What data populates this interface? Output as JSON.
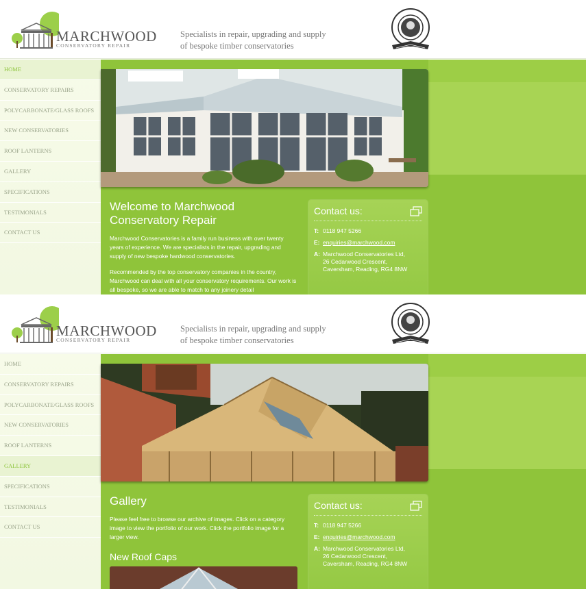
{
  "brand": {
    "name": "MARCHWOOD",
    "sub": "CONSERVATORY REPAIR",
    "tagline_1": "Specialists in repair, upgrading and supply",
    "tagline_2": "of bespoke timber conservatories",
    "badge_alt": "Guild of Master Craftsmen"
  },
  "nav": [
    {
      "label": "HOME"
    },
    {
      "label": "CONSERVATORY REPAIRS"
    },
    {
      "label": "POLYCARBONATE/GLASS ROOFS"
    },
    {
      "label": "NEW CONSERVATORIES"
    },
    {
      "label": "ROOF LANTERNS"
    },
    {
      "label": "GALLERY"
    },
    {
      "label": "SPECIFICATIONS"
    },
    {
      "label": "TESTIMONIALS"
    },
    {
      "label": "CONTACT US"
    }
  ],
  "contact": {
    "title": "Contact us:",
    "t_label": "T:",
    "phone": "0118 947 5266",
    "e_label": "E:",
    "email": "enquiries@marchwood.com",
    "a_label": "A:",
    "addr_1": "Marchwood Conservatories Ltd,",
    "addr_2": "26 Cedarwood Crescent,",
    "addr_3": "Caversham, Reading, RG4 8NW"
  },
  "home": {
    "title_1": "Welcome to Marchwood",
    "title_2": "Conservatory Repair",
    "p1": "Marchwood Conservatories is a family run business with over twenty years of experience. We are specialists in the repair, upgrading and supply of new bespoke hardwood conservatories.",
    "p2": "Recommended by the top conservatory companies in the country, Marchwood can deal with all your conservatory requirements. Our work is all bespoke, so we are able to match to any joinery detail"
  },
  "gallery": {
    "title": "Gallery",
    "p1": "Please feel free to browse our archive of images. Click on a category image to view the portfolio of our work. Click the portfolio image for a larger view.",
    "subtitle": "New Roof Caps"
  },
  "colors": {
    "green": "#8fc43a",
    "active_text": "#8cc43a",
    "nav_text": "#9aa48a"
  },
  "icons": [
    "trees-logo-icon",
    "guild-badge-icon",
    "chat-icon"
  ]
}
